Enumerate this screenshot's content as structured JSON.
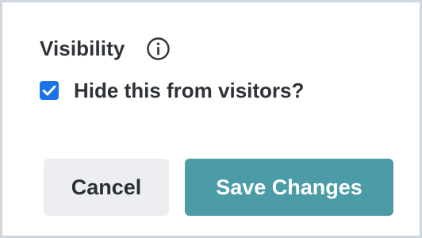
{
  "field": {
    "label": "Visibility",
    "info_icon": "info-circle-icon"
  },
  "checkbox": {
    "label": "Hide this from visitors?",
    "checked": true,
    "icon": "checkmark-icon",
    "color": "#1a73e8"
  },
  "actions": {
    "cancel_label": "Cancel",
    "save_label": "Save Changes",
    "save_color": "#4b9ca6",
    "cancel_color": "#eceef1"
  }
}
